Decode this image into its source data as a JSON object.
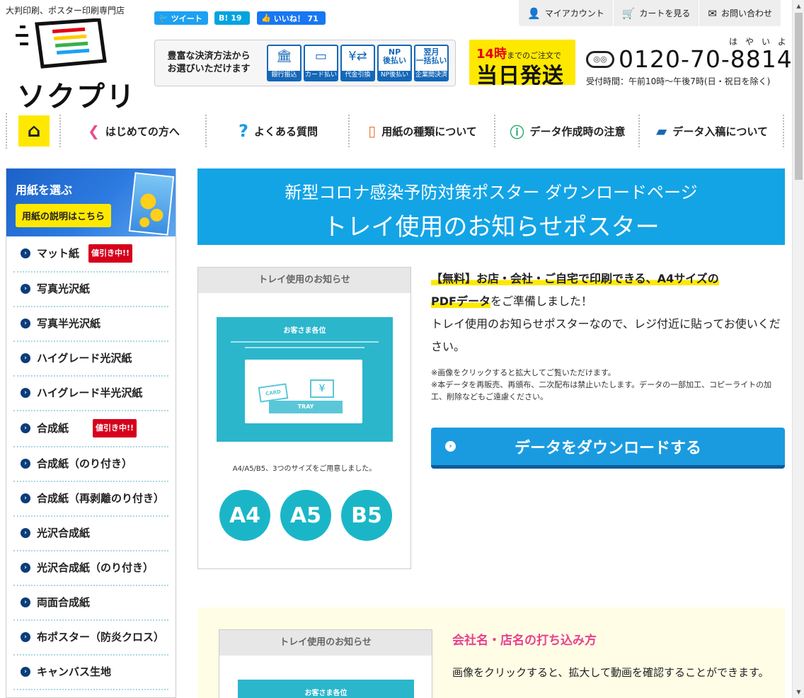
{
  "header": {
    "tagline": "大判印刷、ポスター印刷専門店",
    "logo_text": "ソクプリ",
    "social": {
      "tweet": "ツイート",
      "hatena": "B! 19",
      "like": "いいね！ 71"
    },
    "payment": {
      "title_line1": "豊富な決済方法から",
      "title_line2": "お選びいただけます",
      "methods": [
        {
          "icon": "bank-icon",
          "glyph": "🏛",
          "label": "銀行振込"
        },
        {
          "icon": "card-icon",
          "glyph": "💳",
          "label": "カード払い"
        },
        {
          "icon": "cash-on-delivery-icon",
          "glyph": "¥⇄",
          "label": "代金引換"
        },
        {
          "icon": "np-icon",
          "text": "NP\n後払い",
          "label": "NP後払い"
        },
        {
          "icon": "monthly-icon",
          "text": "翌月\n一括払い",
          "label": "企業間決済"
        }
      ]
    },
    "sameday": {
      "hour": "14時",
      "suffix": "までのご注文で",
      "main": "当日発送"
    },
    "top_nav": [
      {
        "label": "マイアカウント",
        "icon": "person-icon",
        "glyph": "👤"
      },
      {
        "label": "カートを見る",
        "icon": "cart-icon",
        "glyph": "🛒"
      },
      {
        "label": "お問い合わせ",
        "icon": "mail-icon",
        "glyph": "✉"
      }
    ],
    "phone_ruby": "はやいよ",
    "phone": "0120-70-8814",
    "freedial": "FD",
    "hours": "受付時間：午前10時〜午後7時(日・祝日を除く)"
  },
  "main_nav": [
    {
      "label": "",
      "icon": "home-icon",
      "glyph": "⌂"
    },
    {
      "label": "はじめての方へ",
      "icon": "beginner-icon",
      "glyph": "❮"
    },
    {
      "label": "よくある質問",
      "icon": "question-icon",
      "glyph": "?"
    },
    {
      "label": "用紙の種類について",
      "icon": "paper-icon",
      "glyph": "📄"
    },
    {
      "label": "データ作成時の注意",
      "icon": "caution-icon",
      "glyph": "ⓘ"
    },
    {
      "label": "データ入稿について",
      "icon": "folder-icon",
      "glyph": "📁"
    }
  ],
  "sidebar": {
    "title": "用紙を選ぶ",
    "button": "用紙の説明はこちら",
    "items": [
      {
        "label": "マット紙",
        "badge": "値引き中!!"
      },
      {
        "label": "写真光沢紙",
        "badge": ""
      },
      {
        "label": "写真半光沢紙",
        "badge": ""
      },
      {
        "label": "ハイグレード光沢紙",
        "badge": ""
      },
      {
        "label": "ハイグレード半光沢紙",
        "badge": ""
      },
      {
        "label": "合成紙",
        "badge": "値引き中!!"
      },
      {
        "label": "合成紙（のり付き）",
        "badge": ""
      },
      {
        "label": "合成紙（再剥離のり付き）",
        "badge": ""
      },
      {
        "label": "光沢合成紙",
        "badge": ""
      },
      {
        "label": "光沢合成紙（のり付き）",
        "badge": ""
      },
      {
        "label": "両面合成紙",
        "badge": ""
      },
      {
        "label": "布ポスター（防炎クロス）",
        "badge": ""
      },
      {
        "label": "キャンバス生地",
        "badge": ""
      }
    ]
  },
  "banner": {
    "subtitle": "新型コロナ感染予防対策ポスター ダウンロードページ",
    "title": "トレイ使用のお知らせポスター"
  },
  "preview": {
    "header": "トレイ使用のお知らせ",
    "poster_title": "お客さま各位",
    "card": "CARD",
    "tray": "TRAY",
    "yen": "¥",
    "note": "A4/A5/B5、3つのサイズをご用意しました。",
    "sizes": [
      "A4",
      "A5",
      "B5"
    ]
  },
  "description": {
    "lead1": "【無料】お店・会社・ご自宅で印刷できる、A4サイズの",
    "lead2": "PDFデータ",
    "lead2_tail": "をご準備しました！",
    "body": "トレイ使用のお知らせポスターなので、レジ付近に貼ってお使いください。",
    "note1": "※画像をクリックすると拡大してご覧いただけます。",
    "note2": "※本データを再販売、再頒布、二次配布は禁止いたします。データの一部加工、コピーライトの加工、削除などもご遠慮ください。"
  },
  "download_button": "データをダウンロードする",
  "howto": {
    "preview_header": "トレイ使用のお知らせ",
    "poster_title": "お客さま各位",
    "title": "会社名・店名の打ち込み方",
    "body": "画像をクリックすると、拡大して動画を確認することができます。"
  },
  "colors": {
    "accent_blue": "#13a4e6",
    "button_blue": "#1a9be0",
    "yellow": "#ffe800",
    "sale_red": "#d6001c",
    "pink_heading": "#e8418d",
    "poster_teal": "#2bb6cc"
  }
}
